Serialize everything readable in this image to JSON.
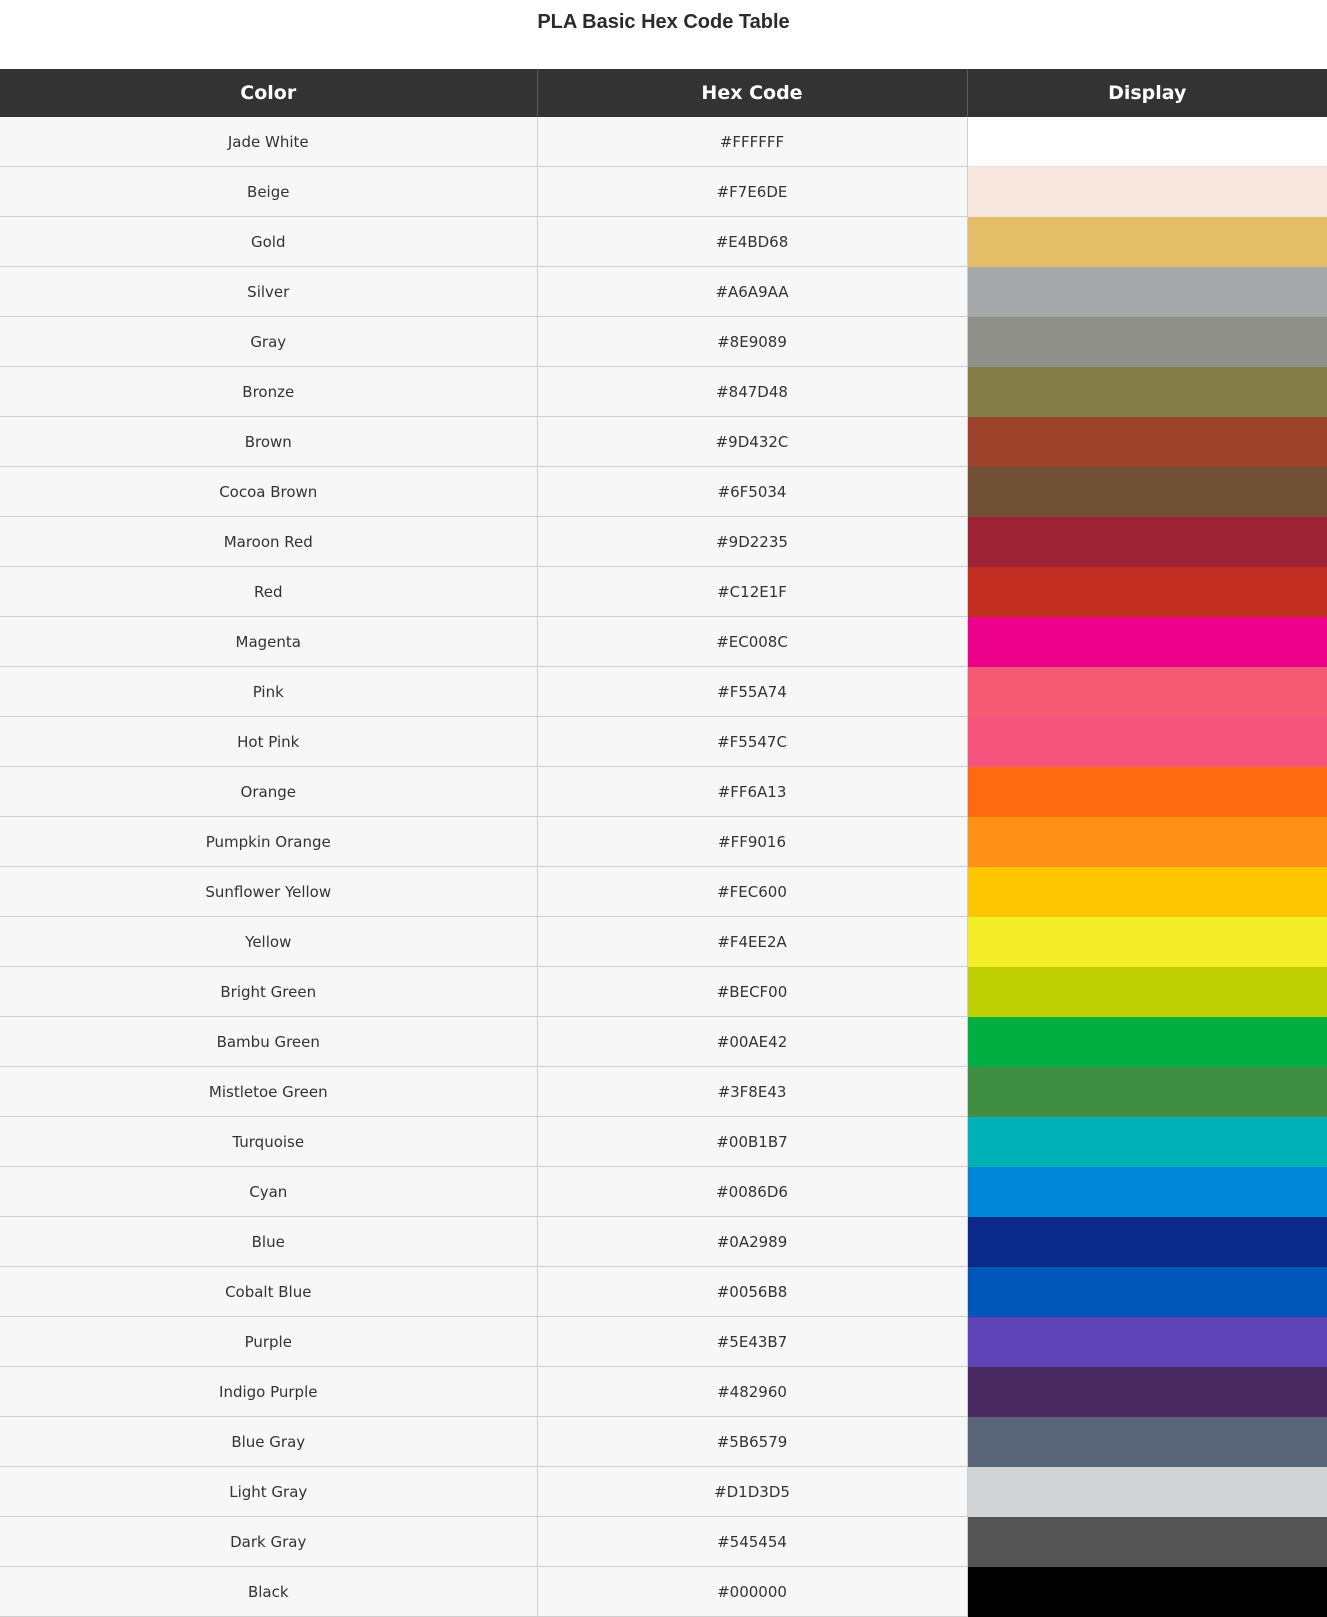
{
  "title": "PLA Basic Hex Code Table",
  "columns": {
    "color": "Color",
    "hex": "Hex Code",
    "display": "Display"
  },
  "rows": [
    {
      "name": "Jade White",
      "hex": "#FFFFFF"
    },
    {
      "name": "Beige",
      "hex": "#F7E6DE"
    },
    {
      "name": "Gold",
      "hex": "#E4BD68"
    },
    {
      "name": "Silver",
      "hex": "#A6A9AA"
    },
    {
      "name": "Gray",
      "hex": "#8E9089"
    },
    {
      "name": "Bronze",
      "hex": "#847D48"
    },
    {
      "name": "Brown",
      "hex": "#9D432C"
    },
    {
      "name": "Cocoa Brown",
      "hex": "#6F5034"
    },
    {
      "name": "Maroon Red",
      "hex": "#9D2235"
    },
    {
      "name": "Red",
      "hex": "#C12E1F"
    },
    {
      "name": "Magenta",
      "hex": "#EC008C"
    },
    {
      "name": "Pink",
      "hex": "#F55A74"
    },
    {
      "name": "Hot Pink",
      "hex": "#F5547C"
    },
    {
      "name": "Orange",
      "hex": "#FF6A13"
    },
    {
      "name": "Pumpkin Orange",
      "hex": "#FF9016"
    },
    {
      "name": "Sunflower Yellow",
      "hex": "#FEC600"
    },
    {
      "name": "Yellow",
      "hex": "#F4EE2A"
    },
    {
      "name": "Bright Green",
      "hex": "#BECF00"
    },
    {
      "name": "Bambu Green",
      "hex": "#00AE42"
    },
    {
      "name": "Mistletoe Green",
      "hex": "#3F8E43"
    },
    {
      "name": "Turquoise",
      "hex": "#00B1B7"
    },
    {
      "name": "Cyan",
      "hex": "#0086D6"
    },
    {
      "name": "Blue",
      "hex": "#0A2989"
    },
    {
      "name": "Cobalt Blue",
      "hex": "#0056B8"
    },
    {
      "name": "Purple",
      "hex": "#5E43B7"
    },
    {
      "name": "Indigo Purple",
      "hex": "#482960"
    },
    {
      "name": "Blue Gray",
      "hex": "#5B6579"
    },
    {
      "name": "Light Gray",
      "hex": "#D1D3D5"
    },
    {
      "name": "Dark Gray",
      "hex": "#545454"
    },
    {
      "name": "Black",
      "hex": "#000000"
    }
  ]
}
